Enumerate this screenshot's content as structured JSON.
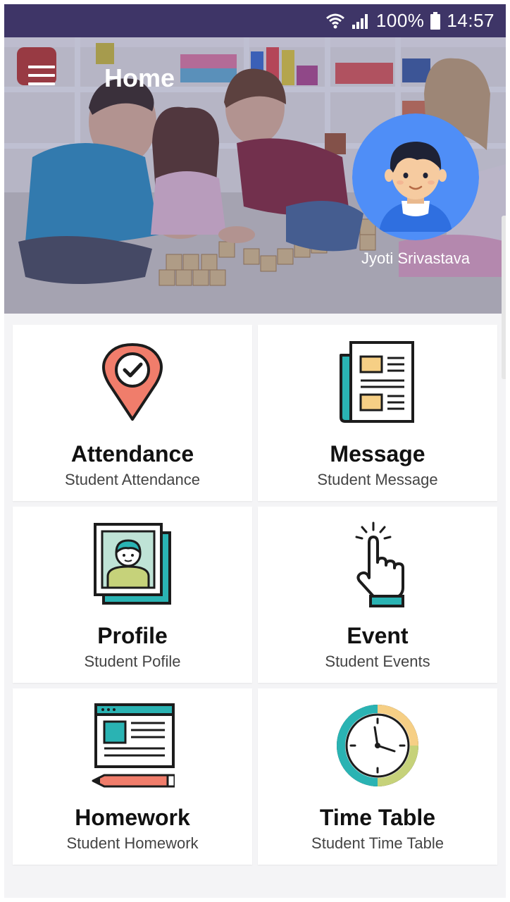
{
  "status_bar": {
    "battery": "100%",
    "time": "14:57",
    "icons": [
      "wifi-icon",
      "signal-icon",
      "battery-icon"
    ]
  },
  "header": {
    "title": "Home",
    "user_name": "Jyoti Srivastava",
    "overlay_color": "#3b3f7a"
  },
  "menu": [
    {
      "title": "Attendance",
      "subtitle": "Student Attendance",
      "icon": "location-pin-check-icon"
    },
    {
      "title": "Message",
      "subtitle": "Student Message",
      "icon": "newspaper-icon"
    },
    {
      "title": "Profile",
      "subtitle": "Student Pofile",
      "icon": "profile-photo-icon"
    },
    {
      "title": "Event",
      "subtitle": "Student Events",
      "icon": "tap-hand-icon"
    },
    {
      "title": "Homework",
      "subtitle": "Student Homework",
      "icon": "document-pencil-icon"
    },
    {
      "title": "Time Table",
      "subtitle": "Student Time Table",
      "icon": "clock-icon"
    }
  ],
  "colors": {
    "status_bar": "#3e3567",
    "teal": "#2ab3b3",
    "coral": "#f07d6b",
    "sand": "#f6cf85",
    "avatar_bg": "#4f8ef7"
  }
}
